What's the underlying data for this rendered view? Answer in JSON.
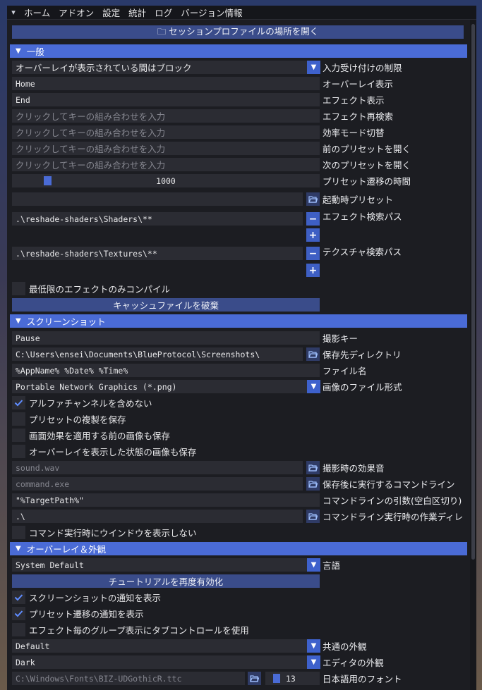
{
  "menubar": {
    "grip": "▾",
    "items": [
      "ホーム",
      "アドオン",
      "設定",
      "統計",
      "ログ",
      "バージョン情報"
    ]
  },
  "top_button": "🗀 セッションプロファイルの場所を開く",
  "general": {
    "header": "一般",
    "block_input_value": "オーバーレイが表示されている間はブロック",
    "block_input_label": "入力受け付けの制限",
    "overlay_key_value": "Home",
    "overlay_key_label": "オーバーレイ表示",
    "effect_key_value": "End",
    "effect_key_label": "エフェクト表示",
    "reload_key_placeholder": "クリックしてキーの組み合わせを入力",
    "reload_key_label": "エフェクト再検索",
    "perf_key_placeholder": "クリックしてキーの組み合わせを入力",
    "perf_key_label": "効率モード切替",
    "prev_key_placeholder": "クリックしてキーの組み合わせを入力",
    "prev_key_label": "前のプリセットを開く",
    "next_key_placeholder": "クリックしてキーの組み合わせを入力",
    "next_key_label": "次のプリセットを開く",
    "transition_value": "1000",
    "transition_label": "プリセット遷移の時間",
    "startup_preset_value": "",
    "startup_preset_label": "起動時プリセット",
    "effect_path_value": ".\\reshade-shaders\\Shaders\\**",
    "effect_path_label": "エフェクト検索パス",
    "texture_path_value": ".\\reshade-shaders\\Textures\\**",
    "texture_path_label": "テクスチャ検索パス",
    "compile_min_label": "最低限のエフェクトのみコンパイル",
    "clear_cache_label": "キャッシュファイルを破棄"
  },
  "screenshot": {
    "header": "スクリーンショット",
    "key_value": "Pause",
    "key_label": "撮影キー",
    "dir_value": "C:\\Users\\ensei\\Documents\\BlueProtocol\\Screenshots\\",
    "dir_label": "保存先ディレクトリ",
    "name_value": "%AppName% %Date% %Time%",
    "name_label": "ファイル名",
    "format_value": "Portable Network Graphics (*.png)",
    "format_label": "画像のファイル形式",
    "no_alpha_label": "アルファチャンネルを含めない",
    "save_preset_label": "プリセットの複製を保存",
    "save_before_label": "画面効果を適用する前の画像も保存",
    "save_overlay_label": "オーバーレイを表示した状態の画像も保存",
    "sound_placeholder": "sound.wav",
    "sound_label": "撮影時の効果音",
    "cmd_placeholder": "command.exe",
    "cmd_label": "保存後に実行するコマンドライン",
    "args_value": "\"%TargetPath%\"",
    "args_label": "コマンドラインの引数(空白区切り)",
    "workdir_value": ".\\",
    "workdir_label": "コマンドライン実行時の作業ディレ",
    "hide_window_label": "コマンド実行時にウインドウを表示しない"
  },
  "overlay": {
    "header": "オーバーレイ＆外観",
    "lang_value": "System Default",
    "lang_label": "言語",
    "tutorial_label": "チュートリアルを再度有効化",
    "notify_ss_label": "スクリーンショットの通知を表示",
    "notify_preset_label": "プリセット遷移の通知を表示",
    "tab_control_label": "エフェクト毎のグループ表示にタブコントロールを使用",
    "theme_value": "Default",
    "theme_label": "共通の外観",
    "editor_theme_value": "Dark",
    "editor_theme_label": "エディタの外観",
    "font_value": "C:\\Windows\\Fonts\\BIZ-UDGothicR.ttc",
    "font_size_value": "13",
    "font_label": "日本語用のフォント"
  },
  "checkbox_states": {
    "compile_min": false,
    "no_alpha": true,
    "save_preset": false,
    "save_before": false,
    "save_overlay": false,
    "hide_window": false,
    "notify_ss": true,
    "notify_preset": true,
    "tab_control": false
  },
  "colors": {
    "accent": "#4a6bd6",
    "panel": "#1c1d22",
    "field": "#2b2c33"
  }
}
